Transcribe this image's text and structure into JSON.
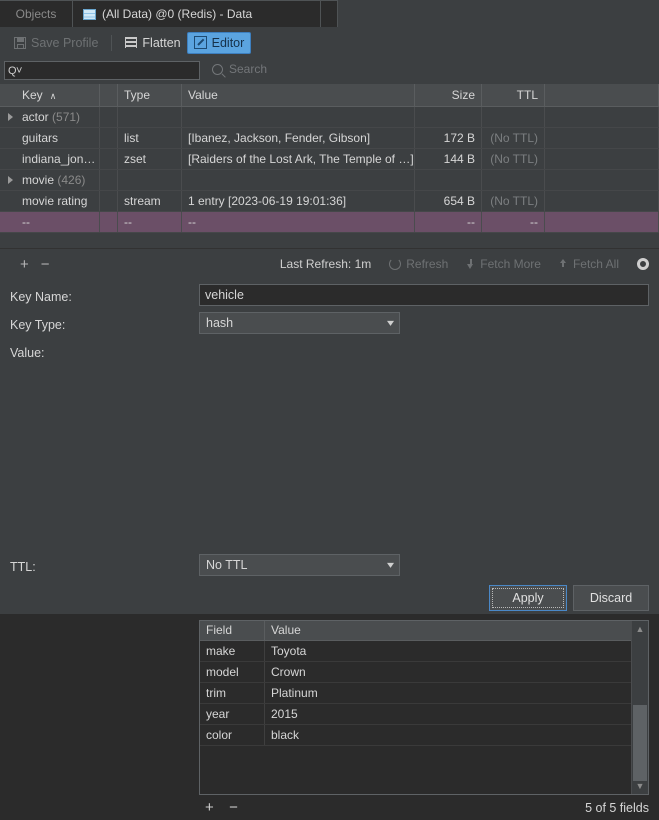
{
  "window": {
    "tabs": [
      {
        "label": "Objects",
        "active": false,
        "icon": ""
      },
      {
        "label": "(All Data) @0 (Redis) - Data",
        "active": true,
        "icon": "redis-icon"
      }
    ]
  },
  "toolbar": {
    "save_profile": "Save Profile",
    "flatten": "Flatten",
    "editor": "Editor",
    "editor_active": true,
    "accent": "#5ba4e0"
  },
  "search": {
    "query_value": "",
    "query_glyph": "Q˅",
    "placeholder": "Search"
  },
  "key_table": {
    "columns": [
      "Key",
      "",
      "Type",
      "Value",
      "Size",
      "TTL",
      ""
    ],
    "sort_column": "Key",
    "sort_caret": "∧",
    "rows": [
      {
        "expandable": true,
        "key": "actor",
        "count": "(571)",
        "type": "",
        "value": "",
        "size": "",
        "ttl": "",
        "selected": false
      },
      {
        "expandable": false,
        "key": "guitars",
        "count": "",
        "type": "list",
        "value": "[Ibanez, Jackson, Fender, Gibson]",
        "size": "172 B",
        "ttl": "(No TTL)",
        "selected": false
      },
      {
        "expandable": false,
        "key": "indiana_jon…",
        "count": "",
        "type": "zset",
        "value": "[Raiders of the Lost Ark, The Temple of …]",
        "size": "144 B",
        "ttl": "(No TTL)",
        "selected": false
      },
      {
        "expandable": true,
        "key": "movie",
        "count": "(426)",
        "type": "",
        "value": "",
        "size": "",
        "ttl": "",
        "selected": false
      },
      {
        "expandable": false,
        "key": "movie rating",
        "count": "",
        "type": "stream",
        "value": "1 entry [2023-06-19 19:01:36]",
        "size": "654 B",
        "ttl": "(No TTL)",
        "selected": false
      },
      {
        "expandable": false,
        "key": "--",
        "count": "",
        "type": "--",
        "value": "--",
        "size": "--",
        "ttl": "--",
        "selected": true
      }
    ],
    "selected_row_color": "#6b4f67"
  },
  "detail_toolbar": {
    "add": "+",
    "remove": "−",
    "last_refresh": "Last Refresh: 1m",
    "refresh": "Refresh",
    "fetch_more": "Fetch More",
    "fetch_all": "Fetch All",
    "settings_icon": "gear-icon"
  },
  "editor": {
    "key_name_label": "Key Name:",
    "key_name_value": "vehicle",
    "key_type_label": "Key Type:",
    "key_type_value": "hash",
    "value_label": "Value:",
    "fields_table": {
      "columns": [
        "Field",
        "Value"
      ],
      "rows": [
        {
          "field": "make",
          "value": "Toyota"
        },
        {
          "field": "model",
          "value": "Crown"
        },
        {
          "field": "trim",
          "value": "Platinum"
        },
        {
          "field": "year",
          "value": "2015"
        },
        {
          "field": "color",
          "value": "black"
        }
      ]
    },
    "add_field": "+",
    "remove_field": "−",
    "field_count": "5 of 5 fields",
    "ttl_label": "TTL:",
    "ttl_value": "No TTL",
    "apply": "Apply",
    "discard": "Discard"
  }
}
